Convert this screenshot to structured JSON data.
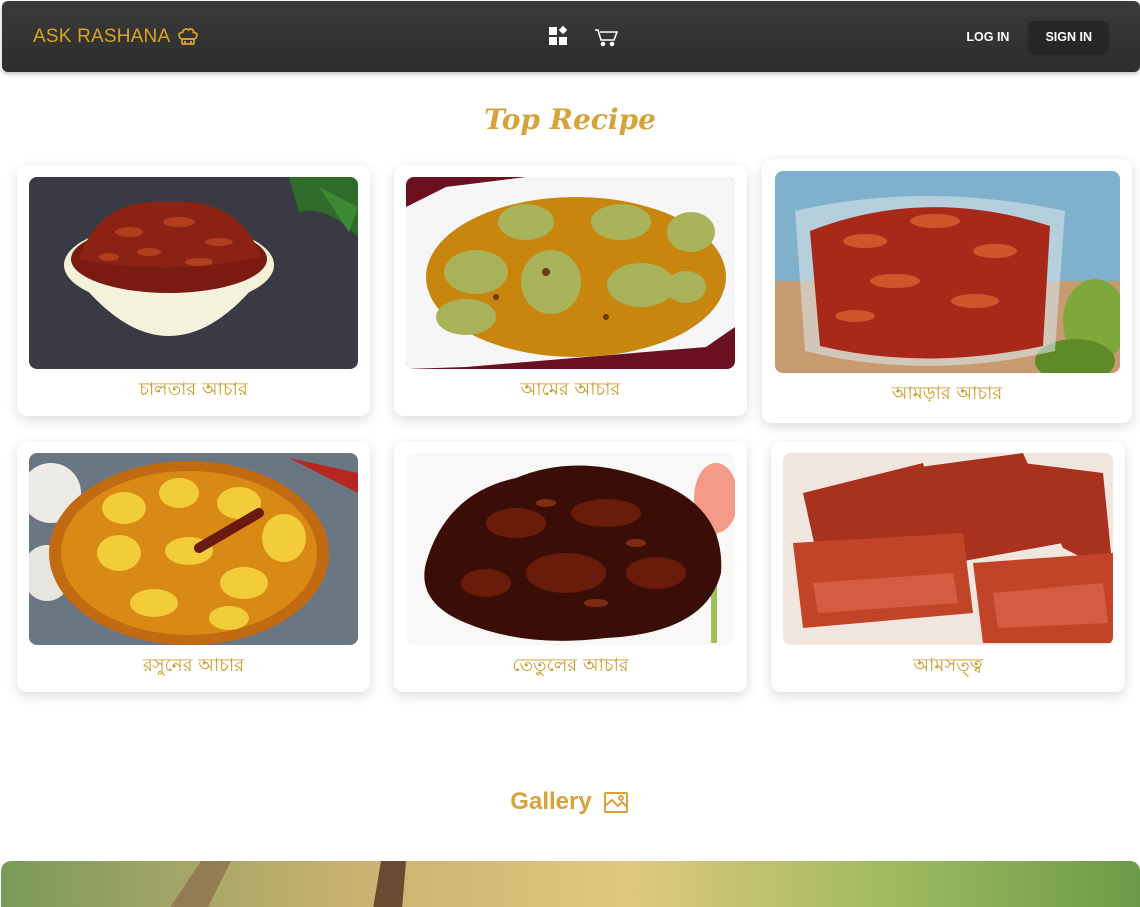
{
  "navbar": {
    "brand": "ASK RASHANA",
    "brand_icon": "chef-hat-icon",
    "icons": [
      "dashboard-icon",
      "cart-icon"
    ],
    "login_label": "LOG IN",
    "signin_label": "SIGN IN"
  },
  "top_recipe": {
    "title": "Top Recipe",
    "cards": [
      {
        "name": "চালতার আচার"
      },
      {
        "name": "আমের আচার"
      },
      {
        "name": "আমড়ার আচার"
      },
      {
        "name": "রসুনের আচার"
      },
      {
        "name": "তেতুলের আচার"
      },
      {
        "name": "আমসত্ত্ব"
      }
    ]
  },
  "gallery": {
    "title": "Gallery",
    "icon": "image-gallery-icon"
  },
  "colors": {
    "accent": "#d6a23a",
    "navbar": "#333333",
    "button_dark": "#262626"
  }
}
